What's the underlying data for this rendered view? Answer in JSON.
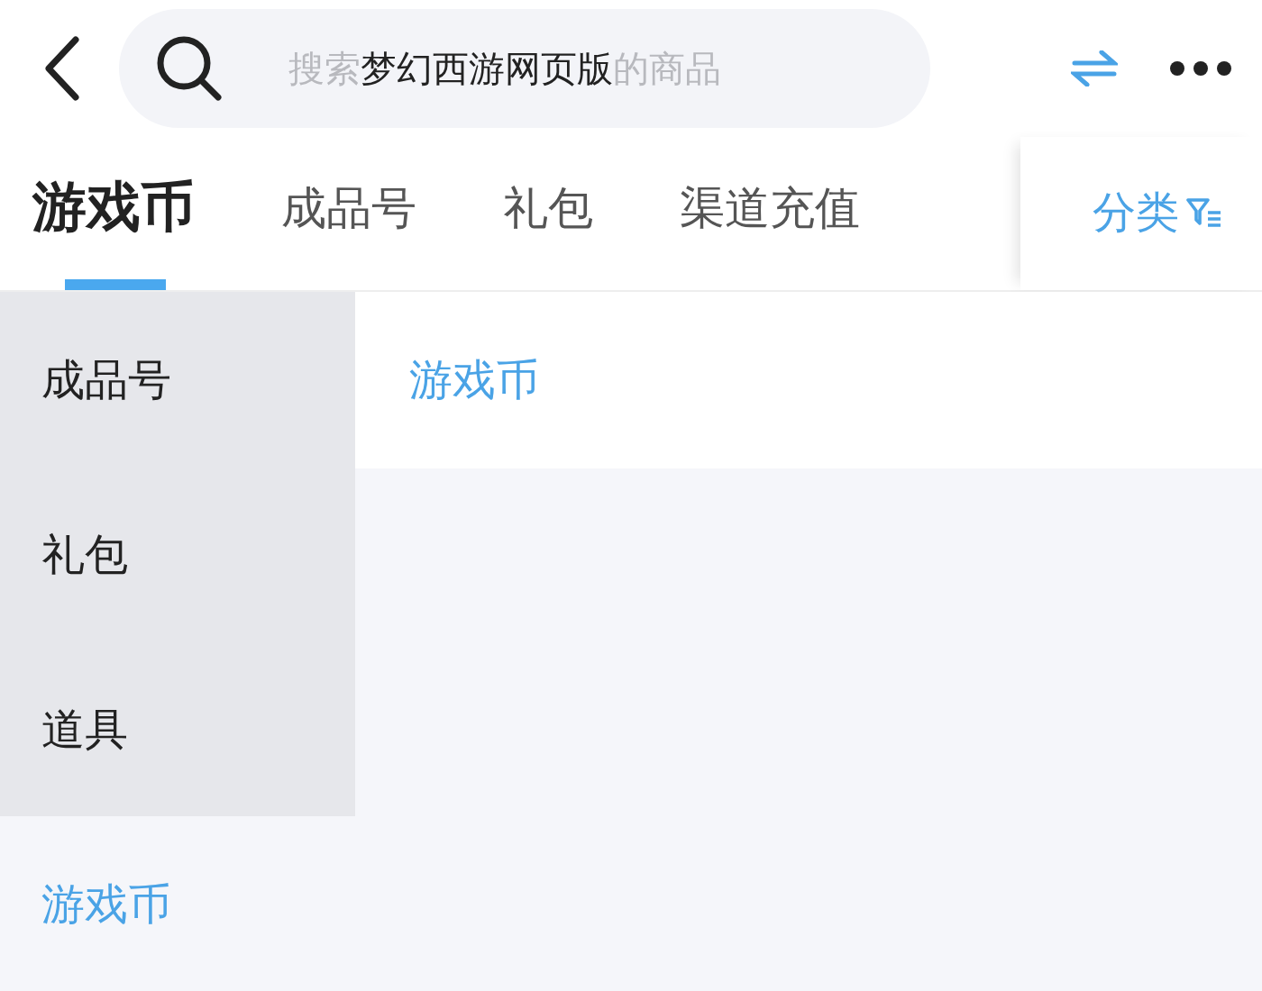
{
  "search": {
    "placeholder": "搜索**梦幻西游网页版**的商品"
  },
  "tabs": [
    {
      "label": "游戏币",
      "selected": true
    },
    {
      "label": "成品号",
      "selected": false
    },
    {
      "label": "礼包",
      "selected": false
    },
    {
      "label": "渠道充值",
      "selected": false
    }
  ],
  "category_button": "分类",
  "sidebar": {
    "items": [
      {
        "label": "成品号",
        "selected": false
      },
      {
        "label": "礼包",
        "selected": false
      },
      {
        "label": "道具",
        "selected": false
      },
      {
        "label": "游戏币",
        "selected": true
      }
    ]
  },
  "content": {
    "heading": "游戏币"
  }
}
